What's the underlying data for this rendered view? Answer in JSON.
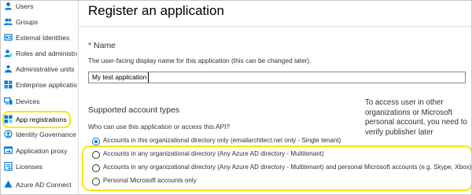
{
  "sidebar": {
    "items": [
      {
        "label": "Users",
        "icon": "users-icon"
      },
      {
        "label": "Groups",
        "icon": "groups-icon"
      },
      {
        "label": "External Identities",
        "icon": "external-identities-icon"
      },
      {
        "label": "Roles and administrators",
        "icon": "roles-icon"
      },
      {
        "label": "Administrative units",
        "icon": "admin-units-icon"
      },
      {
        "label": "Enterprise applications",
        "icon": "enterprise-apps-icon"
      },
      {
        "label": "Devices",
        "icon": "devices-icon"
      },
      {
        "label": "App registrations",
        "icon": "app-registrations-icon",
        "selected": true
      },
      {
        "label": "Identity Governance",
        "icon": "identity-governance-icon"
      },
      {
        "label": "Application proxy",
        "icon": "application-proxy-icon"
      },
      {
        "label": "Licenses",
        "icon": "licenses-icon"
      },
      {
        "label": "Azure AD Connect",
        "icon": "connect-icon"
      }
    ]
  },
  "main": {
    "title": "Register an application",
    "name_section": {
      "required_mark": "*",
      "label": "Name",
      "help": "The user-facing display name for this application (this can be changed later).",
      "input_value": "My test application"
    },
    "account_types": {
      "title": "Supported account types",
      "question": "Who can use this application or access this API?",
      "options": [
        {
          "label": "Accounts in this organizational directory only (emailarchitect.net only - Single tenant)",
          "checked": true
        },
        {
          "label": "Accounts in any organizational directory (Any Azure AD directory - Multitenant)",
          "checked": false
        },
        {
          "label": "Accounts in any organizational directory (Any Azure AD directory - Multitenant) and personal Microsoft accounts (e.g. Skype, Xbox)",
          "checked": false
        },
        {
          "label": "Personal Microsoft accounts only",
          "checked": false
        }
      ]
    },
    "note": "To access user in other organizations or Microsoft personal account, you need to verify publisher later"
  },
  "colors": {
    "highlight": "#f5e90f",
    "accent": "#0078d4",
    "required": "#a4262c"
  }
}
